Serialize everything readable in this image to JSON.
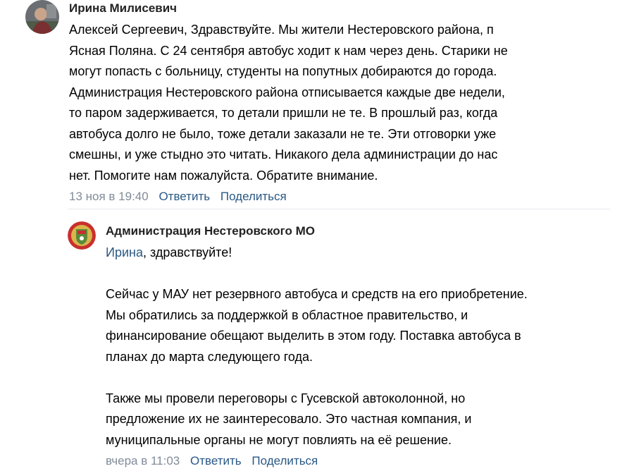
{
  "comments": [
    {
      "author": "Ирина Милисевич",
      "lines": [
        "Алексей Сергеевич, Здравствуйте. Мы жители Нестеровского района, п",
        "Ясная Поляна. С 24 сентября автобус ходит к нам через день. Старики не",
        "могут попасть с больницу, студенты на попутных добираются до города.",
        "Администрация Нестеровского района отписывается каждые две недели,",
        "то паром задерживается, то детали пришли не те. В прошлый раз, когда",
        "автобуса долго не было, тоже детали заказали не те. Эти отговорки уже",
        "смешны, и уже стыдно это читать. Никакого дела администрации до нас",
        "нет. Помогите нам пожалуйста. Обратите внимание."
      ],
      "date": "13 ноя в 19:40",
      "reply_label": "Ответить",
      "share_label": "Поделиться"
    },
    {
      "author": "Администрация Нестеровского МО",
      "greeting_name": "Ирина",
      "greeting_rest": ", здравствуйте!",
      "para1": [
        "Сейчас у МАУ нет резервного автобуса и средств на его приобретение.",
        "Мы обратились за поддержкой в областное правительство, и",
        "финансирование обещают выделить в этом году. Поставка автобуса в",
        "планах до марта следующего года."
      ],
      "para2": [
        "Также мы провели переговоры с Гусевской автоколонной, но",
        "предложение их не заинтересовало. Это частная компания, и",
        "муниципальные органы не могут повлиять на её решение."
      ],
      "date": "вчера в 11:03",
      "reply_label": "Ответить",
      "share_label": "Поделиться"
    }
  ],
  "icons": {
    "user_avatar": "user-avatar-photo",
    "org_avatar": "coat-of-arms-avatar"
  },
  "colors": {
    "link": "#2a5885",
    "meta": "#818c99",
    "divider": "#e7e8ec",
    "emblem_red": "#c8302e",
    "emblem_green": "#5a8a3a",
    "emblem_gold": "#d9b54a"
  }
}
